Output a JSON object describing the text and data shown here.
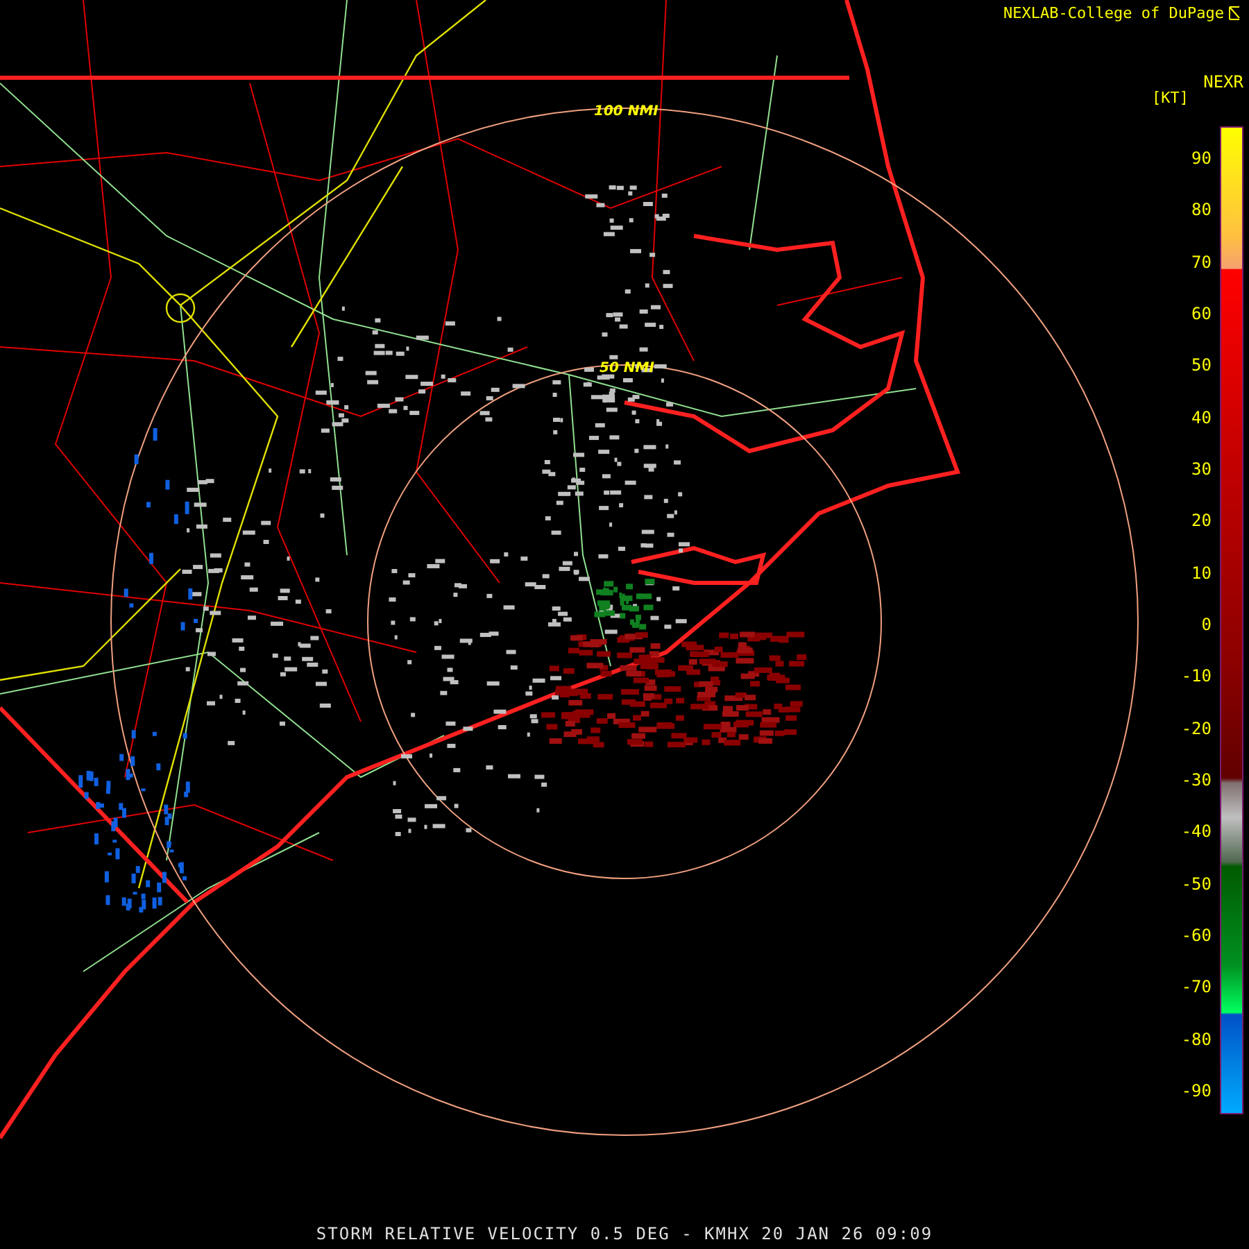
{
  "credit": "NEXLAB-College of DuPage",
  "legend": {
    "title": "NEXR",
    "unit": "[KT]",
    "ticks": [
      "90",
      "80",
      "70",
      "60",
      "50",
      "40",
      "30",
      "20",
      "10",
      "0",
      "-10",
      "-20",
      "-30",
      "-40",
      "-50",
      "-60",
      "-70",
      "-80",
      "-90"
    ]
  },
  "range_rings": [
    "100 NMI",
    "50 NMI"
  ],
  "caption": "STORM RELATIVE VELOCITY 0.5 DEG - KMHX 20 JAN 26 09:09"
}
